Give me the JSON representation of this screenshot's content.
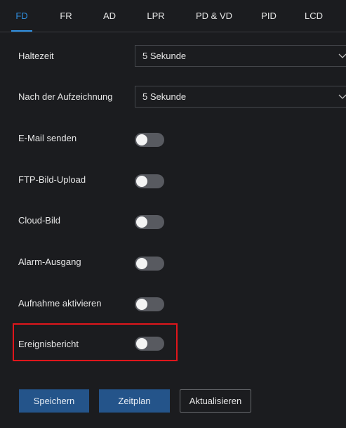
{
  "tabs": [
    {
      "label": "FD",
      "active": true
    },
    {
      "label": "FR",
      "active": false
    },
    {
      "label": "AD",
      "active": false
    },
    {
      "label": "LPR",
      "active": false
    },
    {
      "label": "PD & VD",
      "active": false
    },
    {
      "label": "PID",
      "active": false
    },
    {
      "label": "LCD",
      "active": false
    }
  ],
  "form": {
    "haltezeit": {
      "label": "Haltezeit",
      "value": "5 Sekunde"
    },
    "nach_aufzeichnung": {
      "label": "Nach der Aufzeichnung",
      "value": "5 Sekunde"
    },
    "email": {
      "label": "E-Mail senden",
      "enabled": false
    },
    "ftp": {
      "label": "FTP-Bild-Upload",
      "enabled": false
    },
    "cloud": {
      "label": "Cloud-Bild",
      "enabled": false
    },
    "alarm": {
      "label": "Alarm-Ausgang",
      "enabled": false
    },
    "aufnahme": {
      "label": "Aufnahme aktivieren",
      "enabled": false
    },
    "ereignis": {
      "label": "Ereignisbericht",
      "enabled": false,
      "highlighted": true
    }
  },
  "buttons": {
    "save": "Speichern",
    "schedule": "Zeitplan",
    "refresh": "Aktualisieren"
  },
  "colors": {
    "background": "#1b1c1f",
    "accent": "#2f8fe0",
    "button_primary": "#24548a",
    "highlight_border": "#e0161b",
    "toggle_off": "#585a60"
  },
  "icons": {
    "select_arrow": "chevron-down-icon"
  }
}
